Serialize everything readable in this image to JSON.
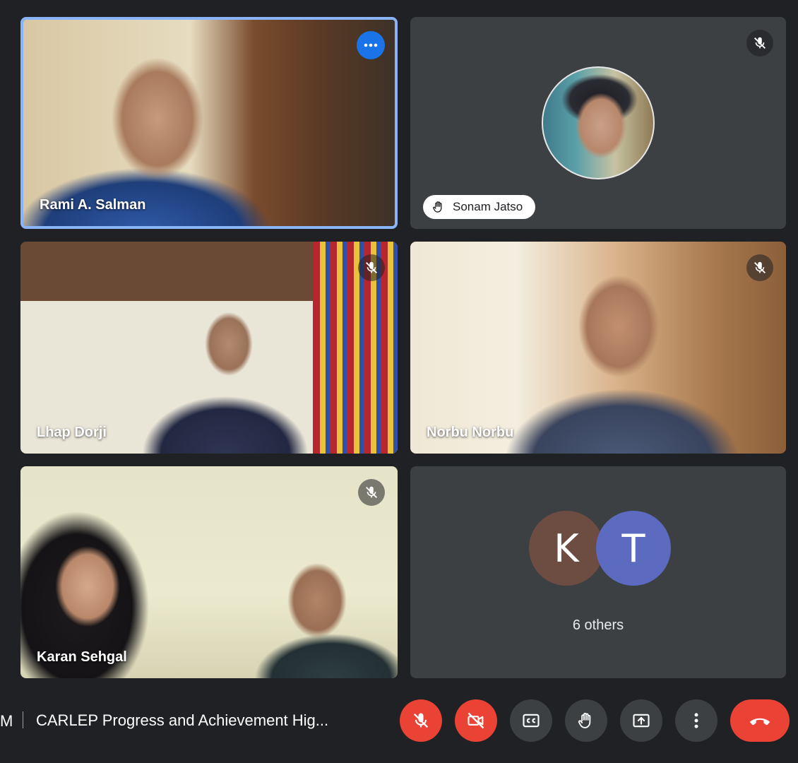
{
  "participants": [
    {
      "name": "Rami A. Salman",
      "muted": false,
      "active_speaker": true
    },
    {
      "name": "Sonam Jatso",
      "muted": true,
      "hand_raised": true
    },
    {
      "name": "Lhap Dorji",
      "muted": true
    },
    {
      "name": "Norbu Norbu",
      "muted": true
    },
    {
      "name": "Karan Sehgal",
      "muted": true
    }
  ],
  "others_tile": {
    "avatars": [
      {
        "letter": "K",
        "color": "#6d4c41"
      },
      {
        "letter": "T",
        "color": "#5c6bc0"
      }
    ],
    "label": "6 others"
  },
  "bottom_bar": {
    "time_fragment": "M",
    "meeting_title": "CARLEP Progress and Achievement Hig..."
  },
  "icons": {
    "more_options": "more-horizontal-icon",
    "mic_off": "mic-off-icon",
    "hand": "raise-hand-icon",
    "camera_off": "camera-off-icon",
    "captions": "closed-captions-icon",
    "present": "present-screen-icon",
    "more_vertical": "more-vertical-icon",
    "end_call": "phone-hangup-icon"
  },
  "colors": {
    "background": "#202124",
    "tile": "#3c4043",
    "accent_blue": "#1a73e8",
    "active_border": "#8ab4f8",
    "danger_red": "#ea4335"
  }
}
